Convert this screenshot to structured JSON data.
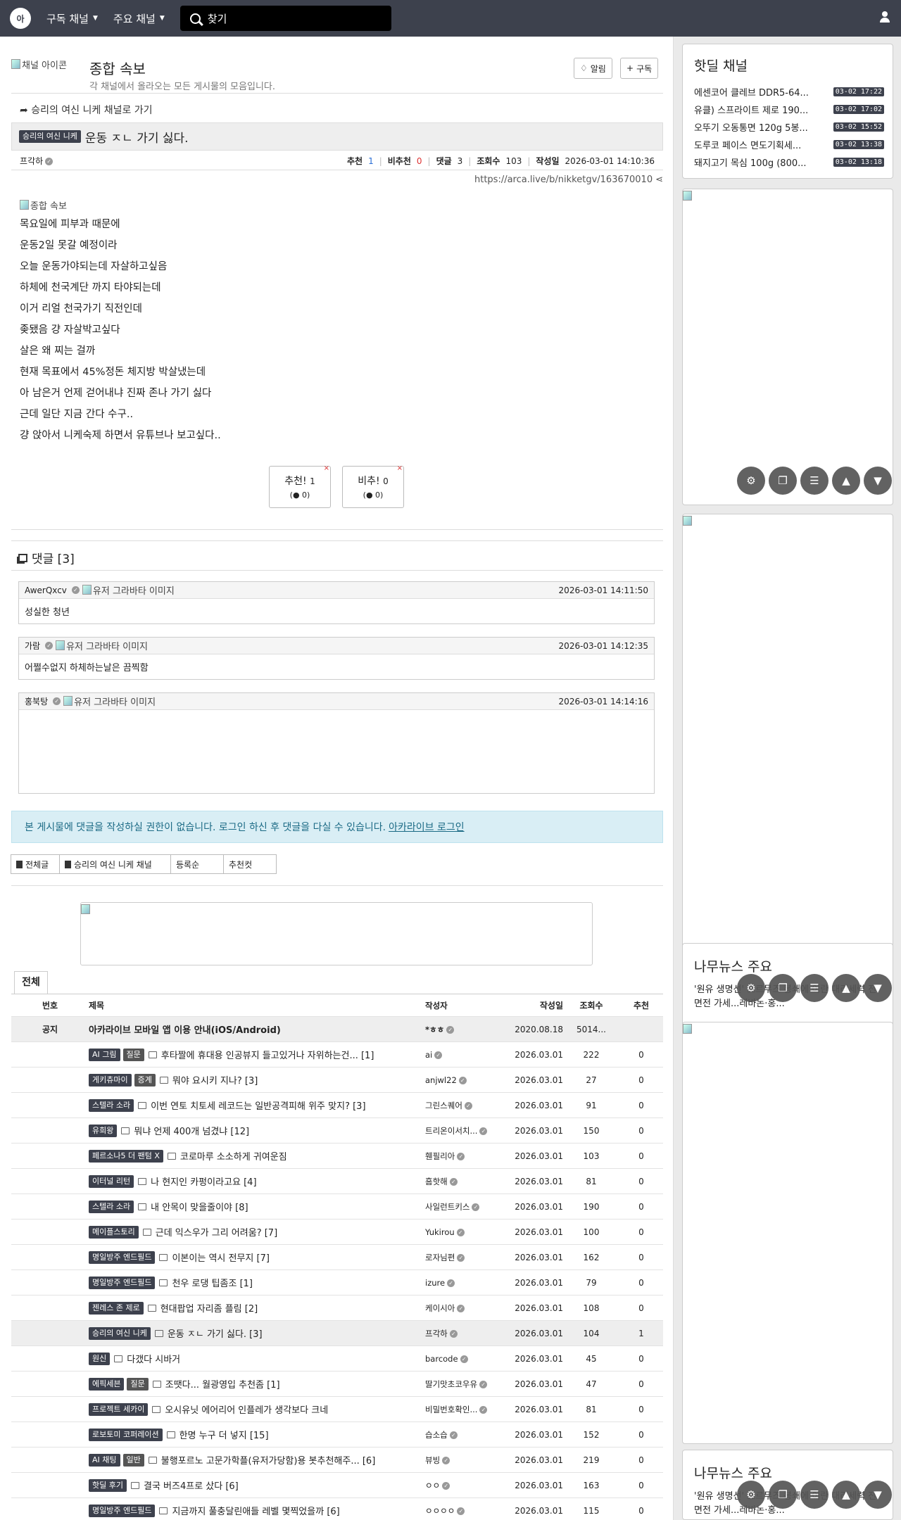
{
  "nav": {
    "menu1": "구독 채널",
    "menu2": "주요 채널",
    "search_placeholder": "찾기"
  },
  "channel": {
    "icon_alt": "채널 아이콘",
    "title": "종합 속보",
    "desc": "각 채널에서 올라오는 모든 게시물의 모음입니다.",
    "alarm_label": "알림",
    "subscribe_label": "구독"
  },
  "post": {
    "go_link": "승리의 여신 니케 채널로 가기",
    "category": "승리의 여신 니케",
    "title": "운동 ㅈㄴ 가기 싫다.",
    "author": "프각하",
    "rec_label": "추천",
    "rec": "1",
    "unrec_label": "비추천",
    "unrec": "0",
    "cmt_label": "댓글",
    "cmt": "3",
    "view_label": "조회수",
    "views": "103",
    "date_label": "작성일",
    "date": "2026-03-01 14:10:36",
    "url": "https://arca.live/b/nikketgv/163670010",
    "image_alt": "종합 속보",
    "lines": [
      "목요일에 피부과 때문에",
      "운동2일 못갈 예정이라",
      "오늘 운동가야되는데 자살하고싶음",
      "하체에 천국계단 까지 타야되는데",
      "이거 리얼 천국가기 직전인데",
      "좆됐음 걍 자살박고싶다",
      "살은 왜 찌는 걸까",
      "현재 목표에서 45%정돈 체지방 박살냈는데",
      "아 남은거 언제 걷어내냐 진짜 존나 가기 싫다",
      "근데 일단 지금 간다 수구..",
      "걍 앉아서 니케숙제 하면서 유튜브나 보고싶다.."
    ],
    "vote_up": "추천!",
    "vote_up_n": "1",
    "vote_up_sub": "0",
    "vote_down": "비추!",
    "vote_down_n": "0",
    "vote_down_sub": "0"
  },
  "comments": {
    "header": "댓글 [3]",
    "avatar_alt": "유저 그라바타 이미지",
    "items": [
      {
        "author": "AwerQxcv",
        "time": "2026-03-01 14:11:50",
        "text": "성실한 청년"
      },
      {
        "author": "가람",
        "time": "2026-03-01 14:12:35",
        "text": "어쩔수없지 하체하는날은 끔찍함"
      },
      {
        "author": "홍북탕",
        "time": "2026-03-01 14:14:16",
        "text": ""
      }
    ]
  },
  "alert": {
    "text": "본 게시물에 댓글을 작성하실 권한이 없습니다. 로그인 하신 후 댓글을 다실 수 있습니다.",
    "link": "아카라이브 로그인"
  },
  "filters": [
    "전체글",
    "승리의 여신 니케 채널",
    "등록순",
    "추천컷"
  ],
  "list": {
    "tab": "전체",
    "headers": [
      "번호",
      "제목",
      "작성자",
      "작성일",
      "조회수",
      "추천"
    ],
    "notice": {
      "no": "공지",
      "title": "아카라이브 모바일 앱 이용 안내(iOS/Android)",
      "author": "*ㅎㅎ",
      "date": "2020.08.18",
      "views": "5014...",
      "rec": ""
    },
    "rows": [
      {
        "b1": "AI 그림",
        "b2": "질문",
        "title": "후타짤에 휴대용 인공뷰지 들고있거나 자위하는건... [1]",
        "author": "ai",
        "date": "2026.03.01",
        "views": "222",
        "rec": "0"
      },
      {
        "b1": "게키츄마이",
        "b2": "증계",
        "title": "뭐야 요시키 지나? [3]",
        "author": "anjwl22",
        "date": "2026.03.01",
        "views": "27",
        "rec": "0"
      },
      {
        "b1": "스텔라 소라",
        "b2": "",
        "title": "이번 연토 치토세 레코드는 일반공격피해 위주 맞지? [3]",
        "author": "그린스퀘어",
        "date": "2026.03.01",
        "views": "91",
        "rec": "0"
      },
      {
        "b1": "유희왕",
        "b2": "",
        "title": "뭐냐 언제 400개 넘겼냐 [12]",
        "author": "트리온이서치...",
        "date": "2026.03.01",
        "views": "150",
        "rec": "0"
      },
      {
        "b1": "페르소나5 더 팬텀 X",
        "b2": "",
        "title": "코로마루 소소하게 귀여운짐",
        "author": "휀필리아",
        "date": "2026.03.01",
        "views": "103",
        "rec": "0"
      },
      {
        "b1": "이터널 리턴",
        "b2": "",
        "title": "나 현지인 카펑이라고요 [4]",
        "author": "흠핫해",
        "date": "2026.03.01",
        "views": "81",
        "rec": "0"
      },
      {
        "b1": "스텔라 소라",
        "b2": "",
        "title": "내 안목이 맞을줄이야 [8]",
        "author": "사일런트키스",
        "date": "2026.03.01",
        "views": "190",
        "rec": "0"
      },
      {
        "b1": "메이플스토리",
        "b2": "",
        "title": "근데 익스우가 그리 어려움? [7]",
        "author": "Yukirou",
        "date": "2026.03.01",
        "views": "100",
        "rec": "0"
      },
      {
        "b1": "명일방주 엔드필드",
        "b2": "",
        "title": "이본이는 역시 전무지 [7]",
        "author": "로자님편",
        "date": "2026.03.01",
        "views": "162",
        "rec": "0"
      },
      {
        "b1": "명일방주 엔드필드",
        "b2": "",
        "title": "천우 로댕 팁좀조 [1]",
        "author": "izure",
        "date": "2026.03.01",
        "views": "79",
        "rec": "0"
      },
      {
        "b1": "젠레스 존 제로",
        "b2": "",
        "title": "현대팝업 자리좀 플림 [2]",
        "author": "케이시아",
        "date": "2026.03.01",
        "views": "108",
        "rec": "0"
      },
      {
        "b1": "승리의 여신 니케",
        "b2": "",
        "title": "운동 ㅈㄴ 가기 싫다. [3]",
        "author": "프각하",
        "date": "2026.03.01",
        "views": "104",
        "rec": "1"
      },
      {
        "b1": "원신",
        "b2": "",
        "title": "다갰다 시바거",
        "author": "barcode",
        "date": "2026.03.01",
        "views": "45",
        "rec": "0"
      },
      {
        "b1": "에픽세븐",
        "b2": "질문",
        "title": "조땟다... 월광영입 추천좀 [1]",
        "author": "딸기맛초코우유",
        "date": "2026.03.01",
        "views": "47",
        "rec": "0"
      },
      {
        "b1": "프로젝트 세카이",
        "b2": "",
        "title": "오시유닛 에어리어 인플레가 생각보다 크네",
        "author": "비밀번호확인...",
        "date": "2026.03.01",
        "views": "81",
        "rec": "0"
      },
      {
        "b1": "로보토미 코퍼레이션",
        "b2": "",
        "title": "한명 누구 더 넣지 [15]",
        "author": "습소습",
        "date": "2026.03.01",
        "views": "152",
        "rec": "0"
      },
      {
        "b1": "AI 채팅",
        "b2": "일반",
        "title": "불행포르노 고문가학플(유저가당함)용 봇추천해주... [6]",
        "author": "뷰빙",
        "date": "2026.03.01",
        "views": "219",
        "rec": "0"
      },
      {
        "b1": "핫딜 후기",
        "b2": "",
        "title": "결국 버즈4프로 샀다 [6]",
        "author": "ㅇㅇ",
        "date": "2026.03.01",
        "views": "163",
        "rec": "0"
      },
      {
        "b1": "명일방주 엔드필드",
        "b2": "",
        "title": "지금까지 풀충달린애들 레벨 몇찍었을까 [6]",
        "author": "ㅇㅇㅇㅇ",
        "date": "2026.03.01",
        "views": "115",
        "rec": "0"
      }
    ]
  },
  "hotdeal": {
    "title": "핫딜 채널",
    "items": [
      {
        "title": "에센코어 클레브 DDR5-64...",
        "time": "03-02 17:22"
      },
      {
        "title": "유클) 스프라이트 제로 190...",
        "time": "03-02 17:02"
      },
      {
        "title": "오뚜기 오동통면 120g 5봉...",
        "time": "03-02 15:52"
      },
      {
        "title": "도루코 페이스 면도기획세...",
        "time": "03-02 13:38"
      },
      {
        "title": "돼지고기 목심 100g (800...",
        "time": "03-02 13:18"
      }
    ]
  },
  "namu": {
    "title": "나무뉴스 주요",
    "text": "'원유 생명선' 호르무즈 봉쇄에 이란 대리세력 전면전 가세...레바논·홍..."
  },
  "icons": [
    "logo-icon",
    "caret-icon",
    "search-icon",
    "user-icon",
    "bell-icon",
    "plus-icon",
    "arrow-icon",
    "share-icon",
    "comment-icon",
    "gear-icon",
    "copy-icon",
    "list-icon",
    "up-icon",
    "down-icon"
  ]
}
